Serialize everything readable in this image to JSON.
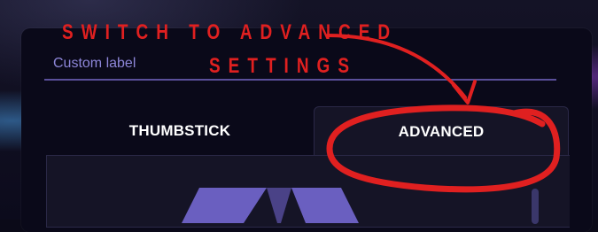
{
  "annotation": {
    "line1": "SWITCH TO ADVANCED",
    "line2": "SETTINGS",
    "color": "#e02020"
  },
  "label_field": {
    "placeholder": "Custom label"
  },
  "tabs": [
    {
      "label": "THUMBSTICK",
      "active": false
    },
    {
      "label": "ADVANCED",
      "active": true
    }
  ],
  "colors": {
    "panel": "#0a0919",
    "tab_active": "#151426",
    "label_text": "#8d86d8",
    "underline": "#5a4f9a",
    "dial": "#6a5fc0"
  }
}
